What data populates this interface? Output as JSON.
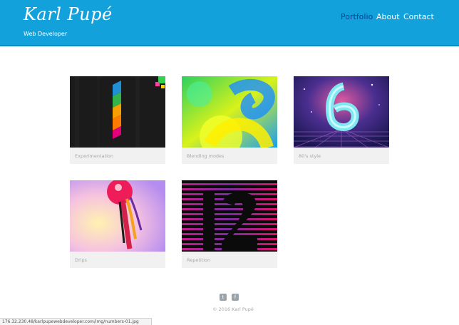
{
  "header": {
    "title": "Karl Pupé",
    "subtitle": "Web Developer",
    "nav": [
      "Portfolio",
      "About",
      "Contact"
    ]
  },
  "cards": [
    {
      "caption": "Experimentation"
    },
    {
      "caption": "Blending modes"
    },
    {
      "caption": "80's style"
    },
    {
      "caption": "Drips"
    },
    {
      "caption": "Repetition"
    }
  ],
  "footer": {
    "social_icons": [
      "twitter-icon",
      "facebook-icon"
    ],
    "copyright": "© 2016 Karl Pupé"
  },
  "statusbar": {
    "url": "176.32.230.48/karlpupewebdeveloper.com/img/numbers-01.jpg"
  },
  "colors": {
    "header_bg": "#12a1db",
    "nav_active": "#0d3c9b",
    "caption": "#a7a7a7"
  }
}
